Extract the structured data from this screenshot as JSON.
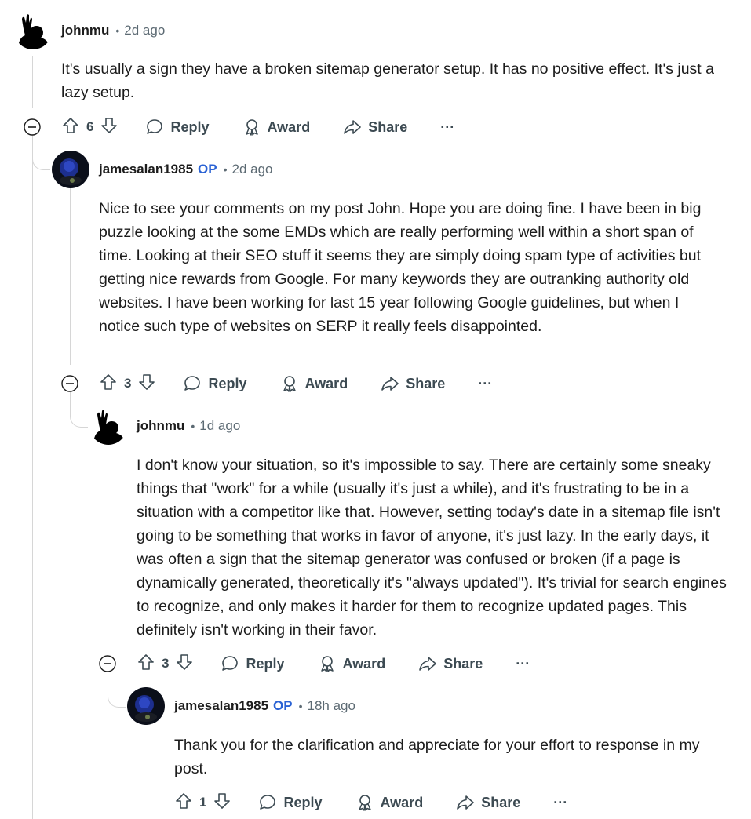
{
  "comments": [
    {
      "author": "johnmu",
      "op_badge": "",
      "separator": "•",
      "time": "2d ago",
      "text": "It's usually a sign they have a broken sitemap generator setup. It has no positive effect. It's just a lazy setup.",
      "votes": "6",
      "actions": {
        "reply": "Reply",
        "award": "Award",
        "share": "Share",
        "more": "···"
      }
    },
    {
      "author": "jamesalan1985",
      "op_badge": "OP",
      "separator": "•",
      "time": "2d ago",
      "text": "Nice to see your comments on my post John. Hope you are doing fine. I have been in big puzzle looking at the some EMDs which are really performing well within a short span of time. Looking at their SEO stuff it seems they are simply doing spam type of activities but getting nice rewards from Google. For many keywords they are outranking authority old websites. I have been working for last 15 year following Google guidelines, but when I notice such type of websites on SERP it really feels disappointed.",
      "votes": "3",
      "actions": {
        "reply": "Reply",
        "award": "Award",
        "share": "Share",
        "more": "···"
      }
    },
    {
      "author": "johnmu",
      "op_badge": "",
      "separator": "•",
      "time": "1d ago",
      "text": "I don't know your situation, so it's impossible to say. There are certainly some sneaky things that \"work\" for a while (usually it's just a while), and it's frustrating to be in a situation with a competitor like that. However, setting today's date in a sitemap file isn't going to be something that works in favor of anyone, it's just lazy. In the early days, it was often a sign that the sitemap generator was confused or broken (if a page is dynamically generated, theoretically it's \"always updated\"). It's trivial for search engines to recognize, and only makes it harder for them to recognize updated pages. This definitely isn't working in their favor.",
      "votes": "3",
      "actions": {
        "reply": "Reply",
        "award": "Award",
        "share": "Share",
        "more": "···"
      }
    },
    {
      "author": "jamesalan1985",
      "op_badge": "OP",
      "separator": "•",
      "time": "18h ago",
      "text": "Thank you for the clarification and appreciate for your effort to response in my post.",
      "votes": "1",
      "actions": {
        "reply": "Reply",
        "award": "Award",
        "share": "Share",
        "more": "···"
      }
    }
  ],
  "icons": {
    "upvote": "upvote-icon",
    "downvote": "downvote-icon",
    "reply": "reply-bubble-icon",
    "award": "award-icon",
    "share": "share-arrow-icon",
    "collapse": "collapse-minus-icon"
  },
  "colors": {
    "op": "#2a62d4",
    "meta": "#5c6a73",
    "action": "#3c4a52",
    "thread": "#d6d6d6"
  }
}
